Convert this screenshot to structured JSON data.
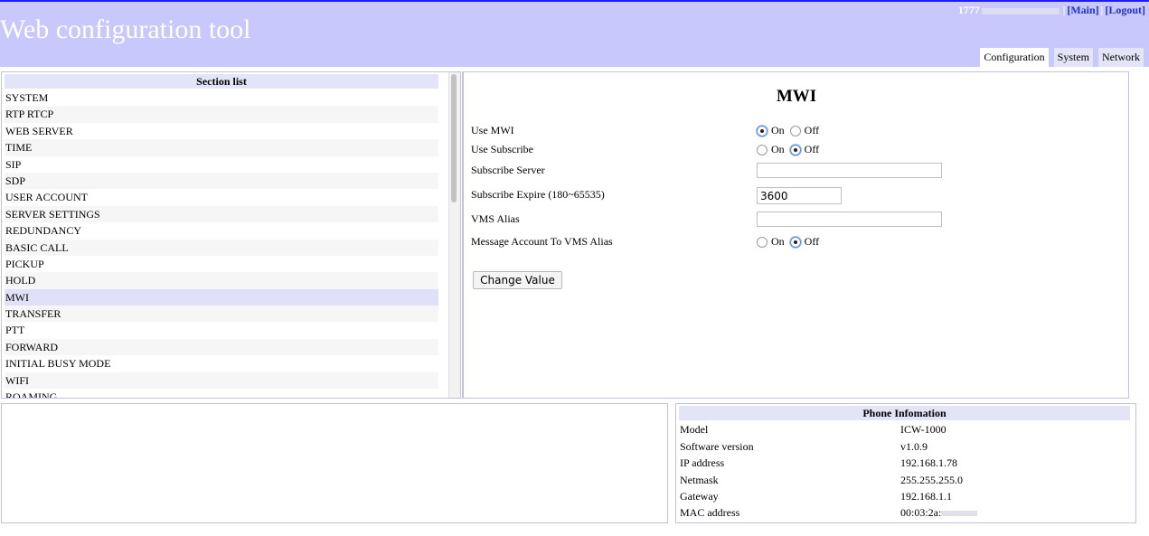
{
  "header": {
    "title": "Web configuration tool",
    "user_id": "1777",
    "main_link": "[Main]",
    "logout_link": "[Logout]",
    "tabs": [
      {
        "label": "Configuration",
        "active": true
      },
      {
        "label": "System",
        "active": false
      },
      {
        "label": "Network",
        "active": false
      }
    ]
  },
  "sections": {
    "heading": "Section list",
    "items": [
      "SYSTEM",
      "RTP RTCP",
      "WEB SERVER",
      "TIME",
      "SIP",
      "SDP",
      "USER ACCOUNT",
      "SERVER SETTINGS",
      "REDUNDANCY",
      "BASIC CALL",
      "PICKUP",
      "HOLD",
      "MWI",
      "TRANSFER",
      "PTT",
      "FORWARD",
      "INITIAL BUSY MODE",
      "WIFI",
      "ROAMING"
    ],
    "active": "MWI"
  },
  "content": {
    "title": "MWI",
    "fields": {
      "use_mwi": {
        "label": "Use MWI",
        "value": "On"
      },
      "use_subscribe": {
        "label": "Use Subscribe",
        "value": "Off"
      },
      "subscribe_server": {
        "label": "Subscribe Server",
        "value": ""
      },
      "subscribe_expire": {
        "label": "Subscribe Expire (180~65535)",
        "value": "3600"
      },
      "vms_alias": {
        "label": "VMS Alias",
        "value": ""
      },
      "msg_account_vms": {
        "label": "Message Account To VMS Alias",
        "value": "Off"
      }
    },
    "on_label": "On",
    "off_label": "Off",
    "change_button": "Change Value"
  },
  "phone_info": {
    "heading": "Phone Infomation",
    "rows": [
      {
        "key": "Model",
        "value": "ICW-1000"
      },
      {
        "key": "Software version",
        "value": "v1.0.9"
      },
      {
        "key": "IP address",
        "value": "192.168.1.78"
      },
      {
        "key": "Netmask",
        "value": "255.255.255.0"
      },
      {
        "key": "Gateway",
        "value": "192.168.1.1"
      },
      {
        "key": "MAC address",
        "value": "00:03:2a:"
      }
    ]
  }
}
